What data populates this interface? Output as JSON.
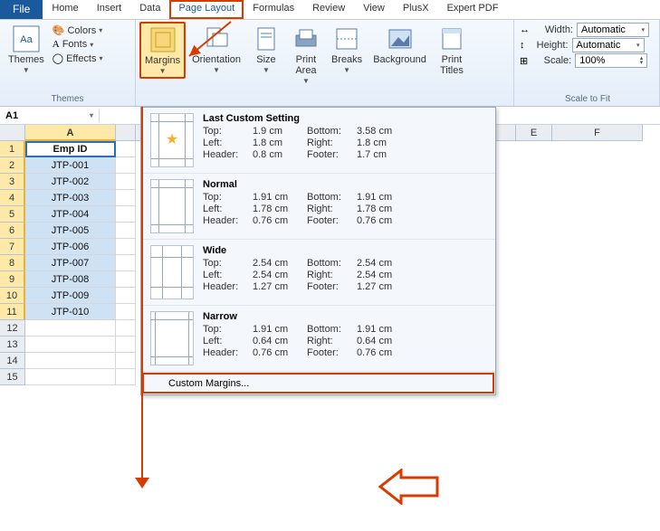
{
  "tabs": {
    "file": "File",
    "home": "Home",
    "insert": "Insert",
    "data": "Data",
    "pageLayout": "Page Layout",
    "formulas": "Formulas",
    "review": "Review",
    "view": "View",
    "plusx": "PlusX",
    "expertpdf": "Expert PDF"
  },
  "themesGroup": {
    "themes": "Themes",
    "colors": "Colors",
    "fonts": "Fonts",
    "effects": "Effects",
    "groupLabel": "Themes"
  },
  "pageSetup": {
    "margins": "Margins",
    "orientation": "Orientation",
    "size": "Size",
    "printArea": "Print\nArea",
    "breaks": "Breaks",
    "background": "Background",
    "printTitles": "Print\nTitles"
  },
  "scaleFit": {
    "widthLabel": "Width:",
    "widthValue": "Automatic",
    "heightLabel": "Height:",
    "heightValue": "Automatic",
    "scaleLabel": "Scale:",
    "scaleValue": "100%",
    "groupLabel": "Scale to Fit"
  },
  "nameBox": "A1",
  "columns": [
    "A",
    "",
    "",
    "",
    "E",
    "F"
  ],
  "rows": [
    "1",
    "2",
    "3",
    "4",
    "5",
    "6",
    "7",
    "8",
    "9",
    "10",
    "11",
    "12",
    "13",
    "14",
    "15"
  ],
  "sheet": {
    "header": "Emp ID",
    "data": [
      "JTP-001",
      "JTP-002",
      "JTP-003",
      "JTP-004",
      "JTP-005",
      "JTP-006",
      "JTP-007",
      "JTP-008",
      "JTP-009",
      "JTP-010"
    ]
  },
  "marginsMenu": {
    "lastCustom": {
      "title": "Last Custom Setting",
      "top": "1.9 cm",
      "bottom": "3.58 cm",
      "left": "1.8 cm",
      "right": "1.8 cm",
      "header": "0.8 cm",
      "footer": "1.7 cm"
    },
    "normal": {
      "title": "Normal",
      "top": "1.91 cm",
      "bottom": "1.91 cm",
      "left": "1.78 cm",
      "right": "1.78 cm",
      "header": "0.76 cm",
      "footer": "0.76 cm"
    },
    "wide": {
      "title": "Wide",
      "top": "2.54 cm",
      "bottom": "2.54 cm",
      "left": "2.54 cm",
      "right": "2.54 cm",
      "header": "1.27 cm",
      "footer": "1.27 cm"
    },
    "narrow": {
      "title": "Narrow",
      "top": "1.91 cm",
      "bottom": "1.91 cm",
      "left": "0.64 cm",
      "right": "0.64 cm",
      "header": "0.76 cm",
      "footer": "0.76 cm"
    },
    "labels": {
      "top": "Top:",
      "bottom": "Bottom:",
      "left": "Left:",
      "right": "Right:",
      "header": "Header:",
      "footer": "Footer:"
    },
    "custom": "Custom Margins..."
  }
}
